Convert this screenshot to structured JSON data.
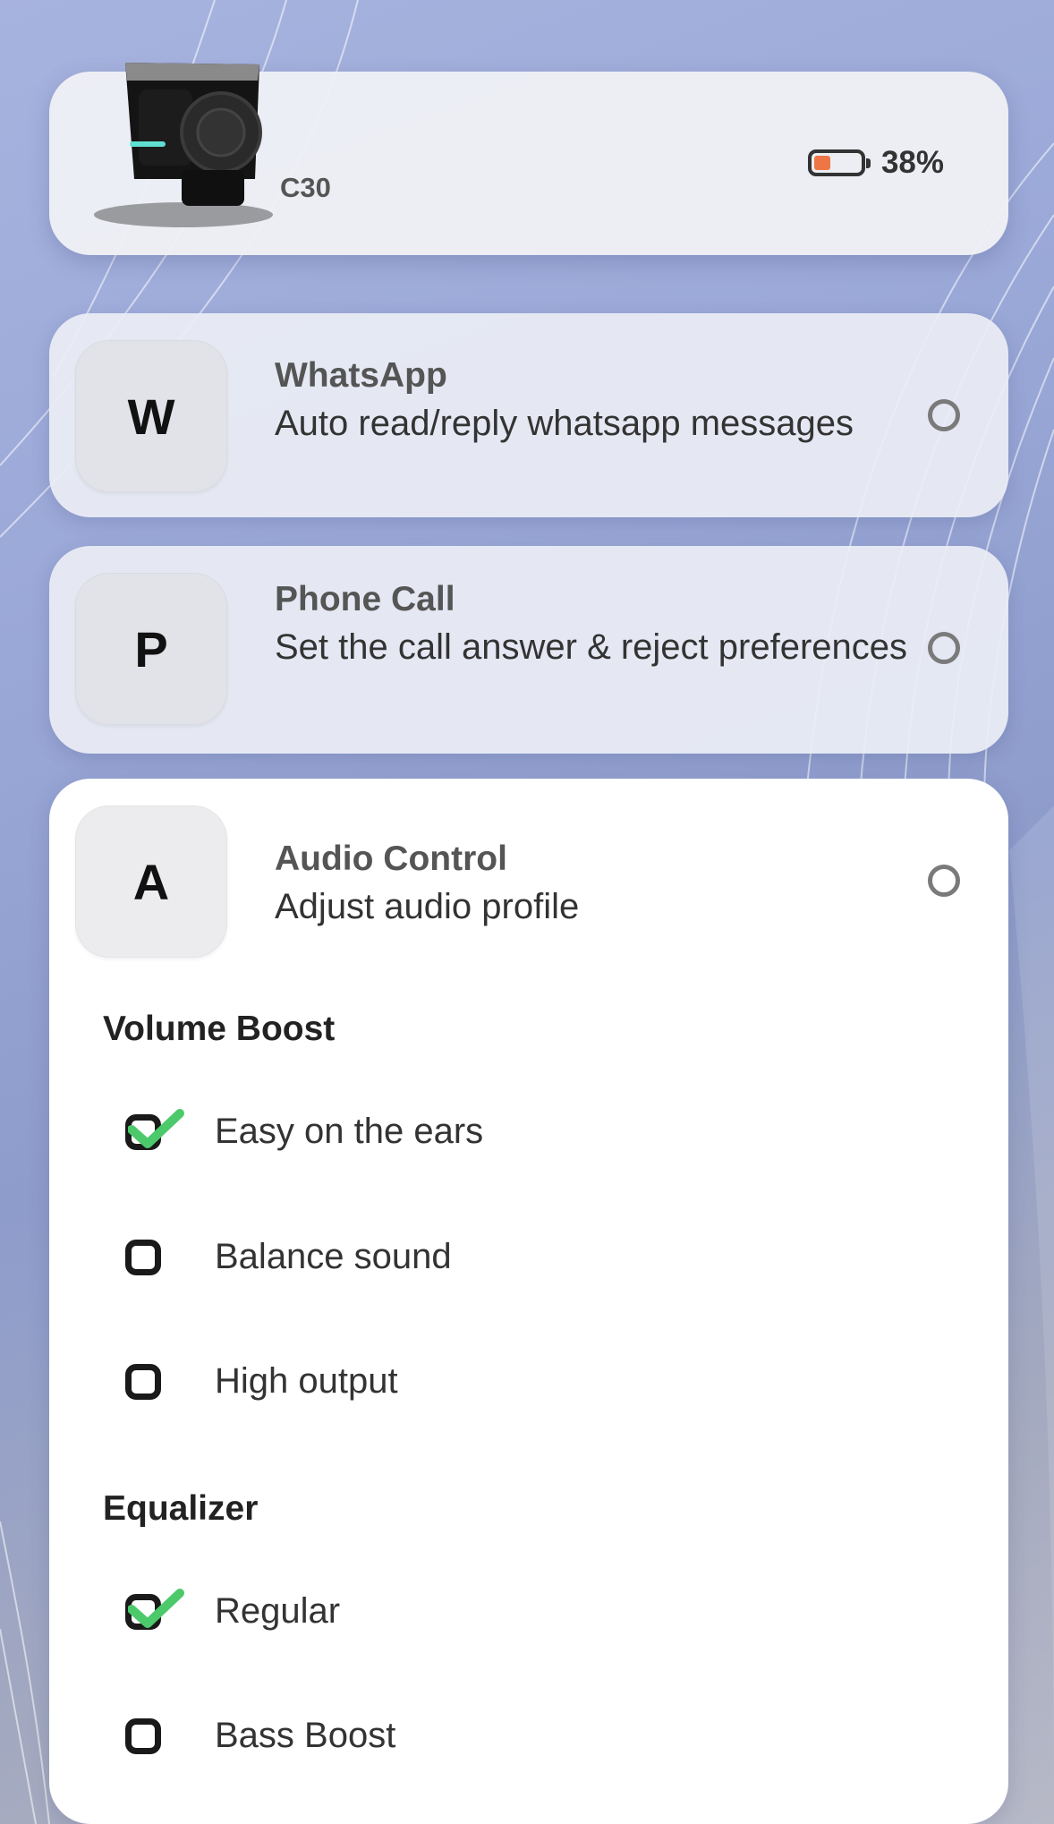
{
  "device": {
    "name": "",
    "model": "C30",
    "battery_percent": 38,
    "battery_text": "38%"
  },
  "features": [
    {
      "letter": "W",
      "title": "WhatsApp",
      "description": "Auto read/reply whatsapp messages",
      "selected": false
    },
    {
      "letter": "P",
      "title": "Phone Call",
      "description": "Set the call answer & reject preferences",
      "selected": false
    },
    {
      "letter": "A",
      "title": "Audio Control",
      "description": "Adjust audio profile",
      "selected": false
    }
  ],
  "audio_control": {
    "volume_boost": {
      "label": "Volume Boost",
      "options": [
        {
          "label": "Easy on the ears",
          "checked": true
        },
        {
          "label": "Balance sound",
          "checked": false
        },
        {
          "label": "High output",
          "checked": false
        }
      ]
    },
    "equalizer": {
      "label": "Equalizer",
      "options": [
        {
          "label": "Regular",
          "checked": true
        },
        {
          "label": "Bass Boost",
          "checked": false
        }
      ]
    }
  },
  "colors": {
    "battery_low": "#ee7646",
    "check_green": "#4cc96a"
  }
}
